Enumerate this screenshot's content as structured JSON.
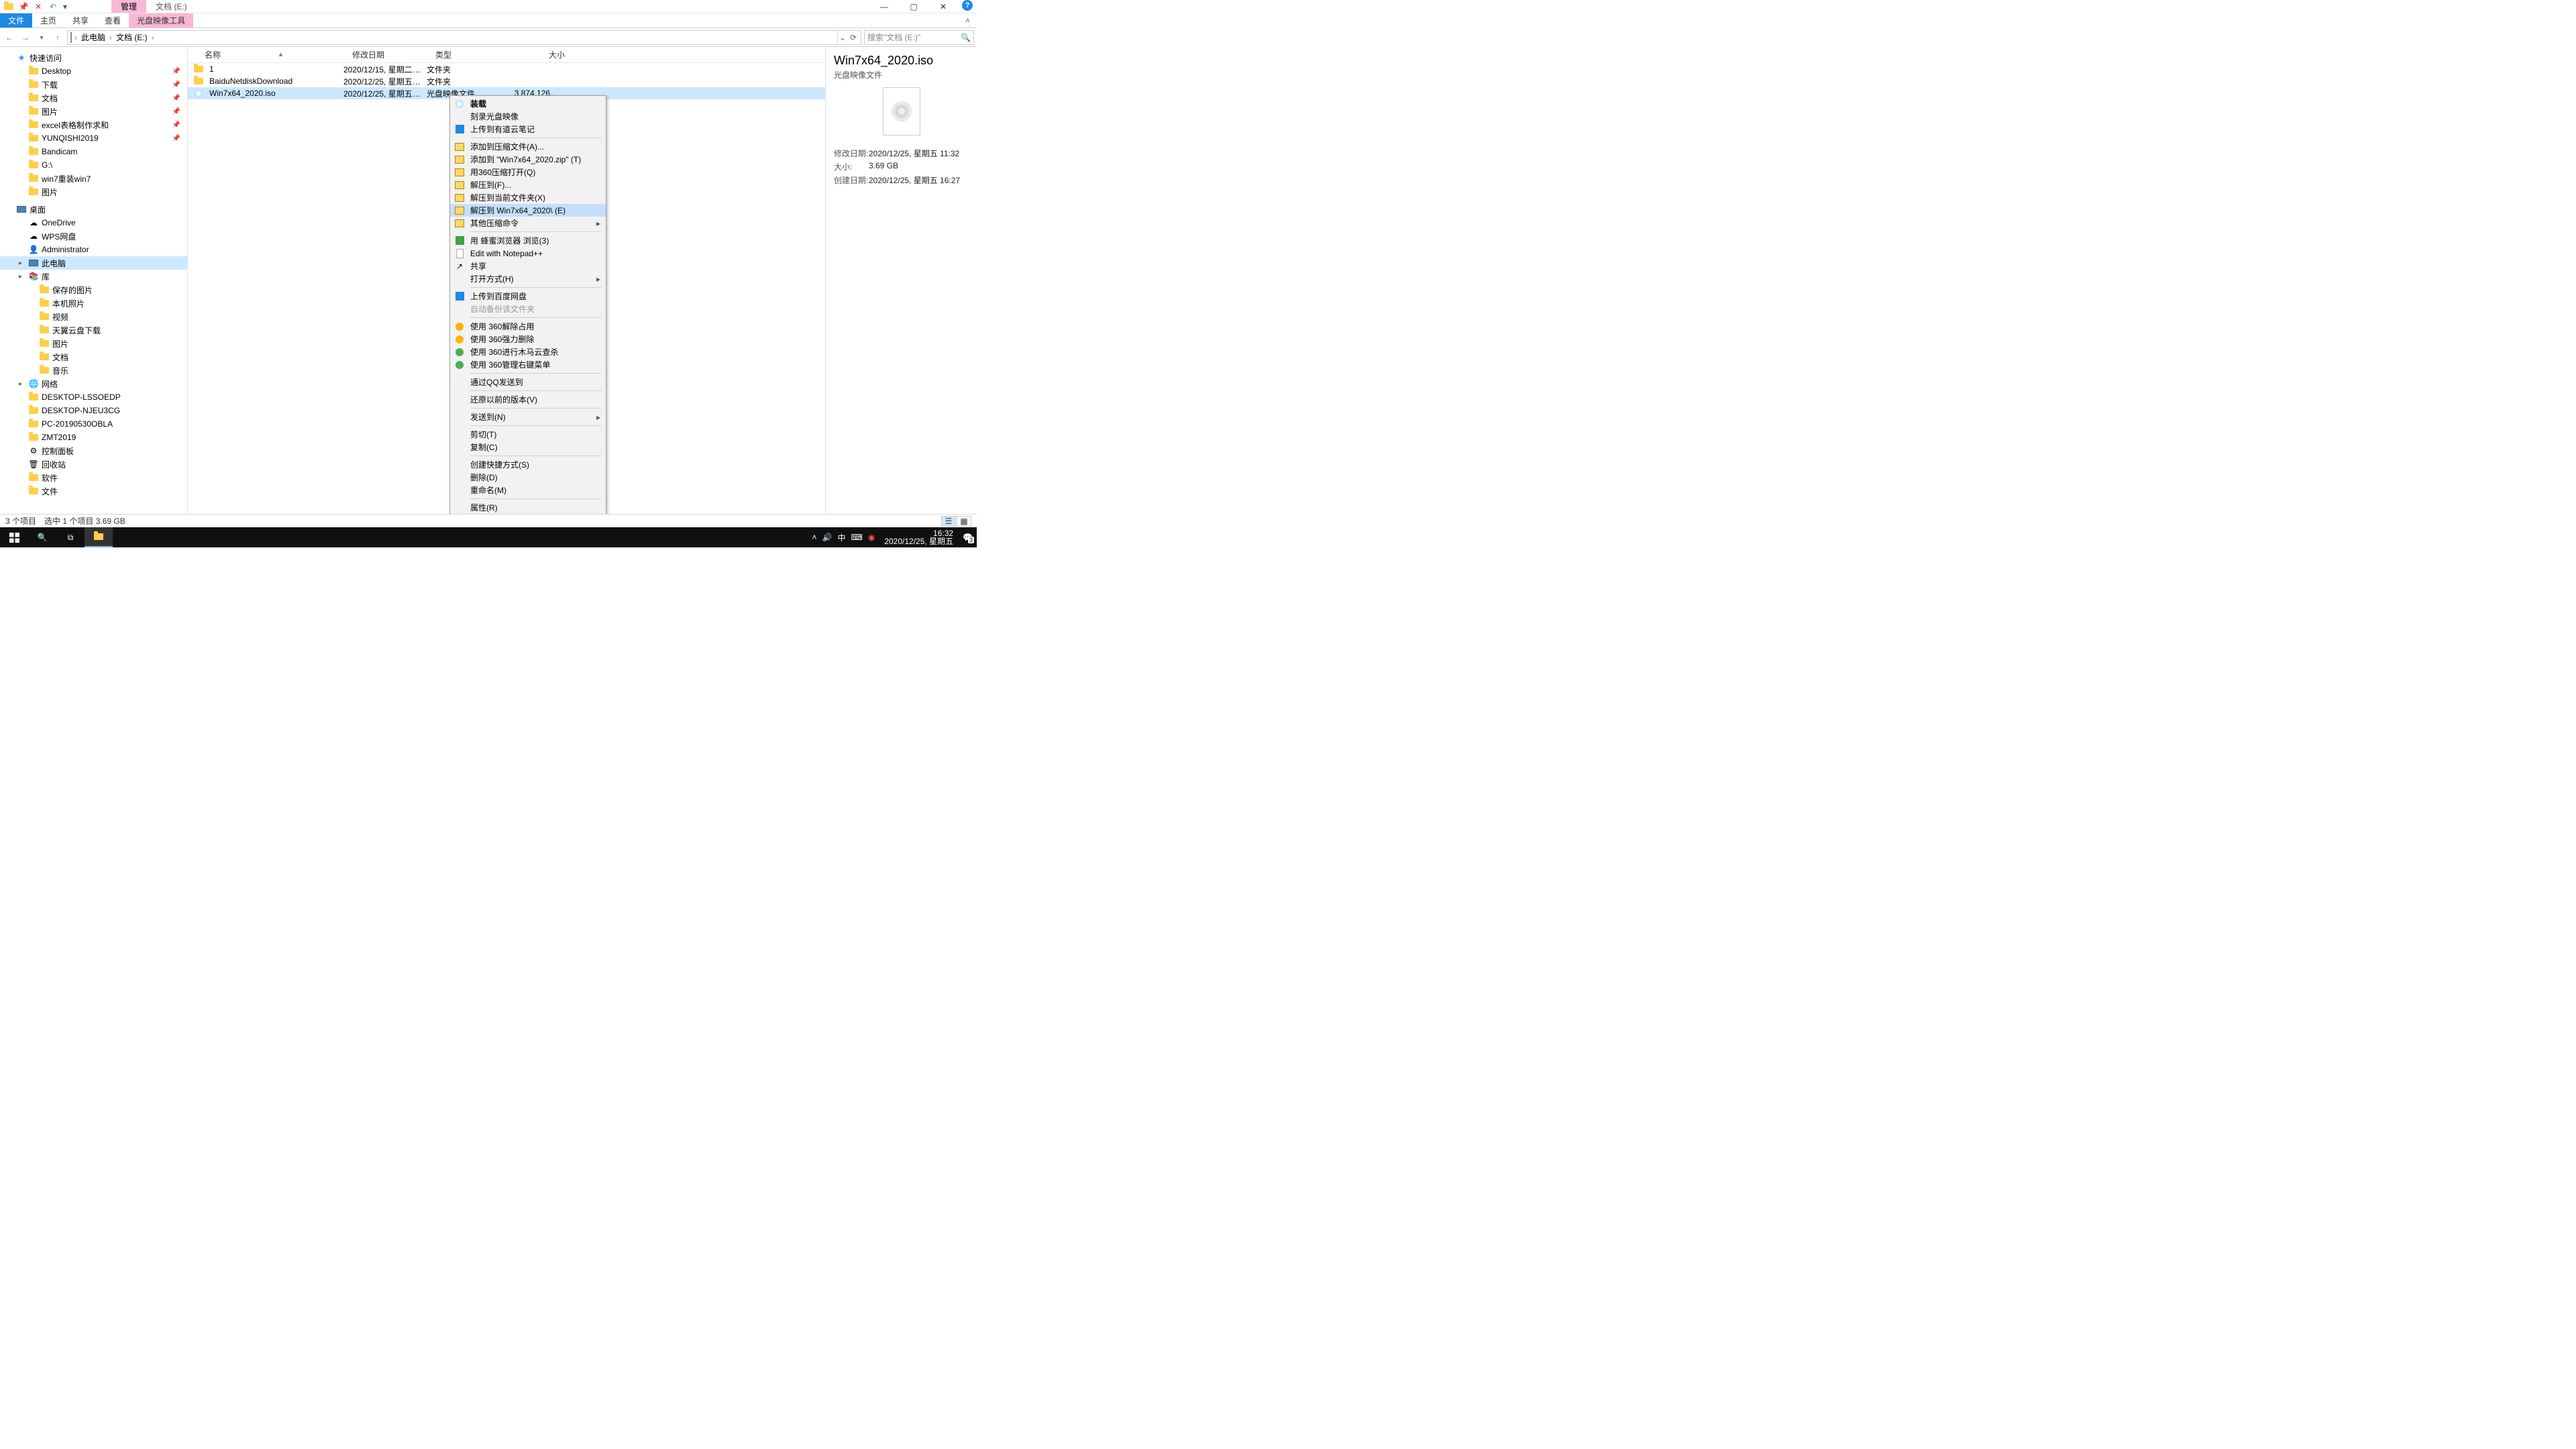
{
  "titlebar": {
    "tab_manage": "管理",
    "tab_title": "文档 (E:)"
  },
  "ribbon": {
    "file": "文件",
    "home": "主页",
    "share": "共享",
    "view": "查看",
    "iso": "光盘映像工具"
  },
  "nav": {
    "root": "此电脑",
    "loc": "文档 (E:)",
    "search_ph": "搜索\"文档 (E:)\""
  },
  "tree": {
    "quick": "快速访问",
    "items": [
      {
        "lbl": "Desktop",
        "pin": true
      },
      {
        "lbl": "下载",
        "pin": true
      },
      {
        "lbl": "文档",
        "pin": true
      },
      {
        "lbl": "图片",
        "pin": true
      },
      {
        "lbl": "excel表格制作求和",
        "pin": true
      },
      {
        "lbl": "YUNQISHI2019",
        "pin": true
      },
      {
        "lbl": "Bandicam"
      },
      {
        "lbl": "G:\\"
      },
      {
        "lbl": "win7重装win7"
      },
      {
        "lbl": "图片"
      }
    ],
    "desktop": "桌面",
    "d_items": [
      "OneDrive",
      "WPS网盘",
      "Administrator",
      "此电脑",
      "库",
      "保存的图片",
      "本机照片",
      "视频",
      "天翼云盘下载",
      "图片",
      "文档",
      "音乐",
      "网络",
      "DESKTOP-LSSOEDP",
      "DESKTOP-NJEU3CG",
      "PC-20190530OBLA",
      "ZMT2019",
      "控制面板",
      "回收站",
      "软件",
      "文件"
    ]
  },
  "columns": {
    "name": "名称",
    "date": "修改日期",
    "type": "类型",
    "size": "大小"
  },
  "rows": [
    {
      "n": "1",
      "d": "2020/12/15, 星期二 1...",
      "t": "文件夹",
      "s": ""
    },
    {
      "n": "BaiduNetdiskDownload",
      "d": "2020/12/25, 星期五 1...",
      "t": "文件夹",
      "s": ""
    },
    {
      "n": "Win7x64_2020.iso",
      "d": "2020/12/25, 星期五 1...",
      "t": "光盘映像文件",
      "s": "3,874,126...",
      "sel": true,
      "iso": true
    }
  ],
  "ctx": [
    {
      "t": "装载",
      "ico": "disc",
      "bold": true
    },
    {
      "t": "刻录光盘映像"
    },
    {
      "t": "上传到有道云笔记",
      "ico": "blue"
    },
    {
      "sep": true
    },
    {
      "t": "添加到压缩文件(A)...",
      "ico": "zip"
    },
    {
      "t": "添加到 \"Win7x64_2020.zip\" (T)",
      "ico": "zip"
    },
    {
      "t": "用360压缩打开(Q)",
      "ico": "zip"
    },
    {
      "t": "解压到(F)...",
      "ico": "zip"
    },
    {
      "t": "解压到当前文件夹(X)",
      "ico": "zip"
    },
    {
      "t": "解压到 Win7x64_2020\\ (E)",
      "ico": "zip",
      "hl": true
    },
    {
      "t": "其他压缩命令",
      "ico": "zip",
      "sub": true
    },
    {
      "sep": true
    },
    {
      "t": "用 蜂蜜浏览器 浏览(3)",
      "ico": "green"
    },
    {
      "t": "Edit with Notepad++",
      "ico": "file"
    },
    {
      "t": "共享",
      "ico": "share"
    },
    {
      "t": "打开方式(H)",
      "sub": true
    },
    {
      "sep": true
    },
    {
      "t": "上传到百度网盘",
      "ico": "blue"
    },
    {
      "t": "自动备份该文件夹",
      "dis": true
    },
    {
      "sep": true
    },
    {
      "t": "使用 360解除占用",
      "ico": "360r"
    },
    {
      "t": "使用 360强力删除",
      "ico": "360r"
    },
    {
      "t": "使用 360进行木马云查杀",
      "ico": "360"
    },
    {
      "t": "使用 360管理右键菜单",
      "ico": "360"
    },
    {
      "sep": true
    },
    {
      "t": "通过QQ发送到"
    },
    {
      "sep": true
    },
    {
      "t": "还原以前的版本(V)"
    },
    {
      "sep": true
    },
    {
      "t": "发送到(N)",
      "sub": true
    },
    {
      "sep": true
    },
    {
      "t": "剪切(T)"
    },
    {
      "t": "复制(C)"
    },
    {
      "sep": true
    },
    {
      "t": "创建快捷方式(S)"
    },
    {
      "t": "删除(D)"
    },
    {
      "t": "重命名(M)"
    },
    {
      "sep": true
    },
    {
      "t": "属性(R)"
    }
  ],
  "details": {
    "name": "Win7x64_2020.iso",
    "type": "光盘映像文件",
    "meta": [
      {
        "k": "修改日期:",
        "v": "2020/12/25, 星期五 11:32"
      },
      {
        "k": "大小:",
        "v": "3.69 GB"
      },
      {
        "k": "创建日期:",
        "v": "2020/12/25, 星期五 16:27"
      }
    ]
  },
  "status": {
    "a": "3 个项目",
    "b": "选中 1 个项目  3.69 GB"
  },
  "taskbar": {
    "ime": "中",
    "time": "16:32",
    "date": "2020/12/25, 星期五",
    "badge": "3"
  }
}
